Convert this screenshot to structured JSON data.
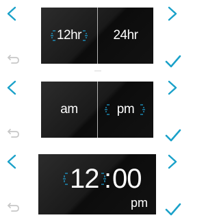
{
  "colors": {
    "accent": "#1aa1c9",
    "icon_gray": "#c8c8c8",
    "panel_bg": "#1a1a1a",
    "text": "#ffffff",
    "selection_mark": "#1e9fd1"
  },
  "icons": {
    "back": "chevron-left-icon",
    "next": "chevron-right-icon",
    "undo": "undo-icon",
    "confirm": "checkmark-icon",
    "selection": "selection-bracket-icon"
  },
  "hour_format": {
    "options": [
      "12hr",
      "24hr"
    ],
    "selected": "12hr"
  },
  "meridiem": {
    "options": [
      "am",
      "pm"
    ],
    "selected": "pm"
  },
  "time": {
    "hours": "12",
    "separator": ":",
    "minutes": "00",
    "period": "pm",
    "editing": "hours"
  }
}
